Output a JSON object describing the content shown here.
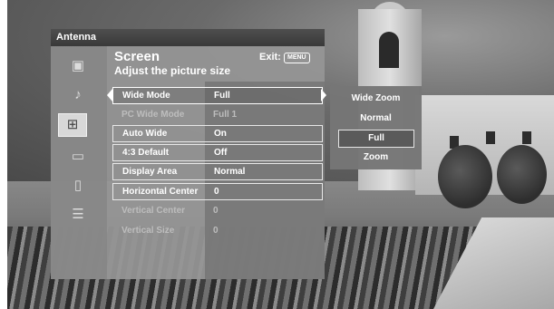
{
  "header": {
    "source": "Antenna"
  },
  "menu": {
    "title": "Screen",
    "subtitle": "Adjust the picture size",
    "exit_label": "Exit:",
    "exit_badge": "MENU"
  },
  "categories": [
    {
      "icon": "picture-icon",
      "glyph": "▣"
    },
    {
      "icon": "sound-icon",
      "glyph": "♪"
    },
    {
      "icon": "screen-icon",
      "glyph": "⊞"
    },
    {
      "icon": "channel-icon",
      "glyph": "▭"
    },
    {
      "icon": "lock-icon",
      "glyph": "▯"
    },
    {
      "icon": "setup-icon",
      "glyph": "☰"
    }
  ],
  "settings": [
    {
      "label": "Wide Mode",
      "value": "Full"
    },
    {
      "label": "PC Wide Mode",
      "value": "Full 1"
    },
    {
      "label": "Auto Wide",
      "value": "On"
    },
    {
      "label": "4:3 Default",
      "value": "Off"
    },
    {
      "label": "Display Area",
      "value": "Normal"
    },
    {
      "label": "Horizontal Center",
      "value": "0"
    },
    {
      "label": "Vertical Center",
      "value": "0"
    },
    {
      "label": "Vertical Size",
      "value": "0"
    }
  ],
  "wide_mode_options": [
    "Wide Zoom",
    "Normal",
    "Full",
    "Zoom"
  ],
  "wide_mode_selected": "Full"
}
